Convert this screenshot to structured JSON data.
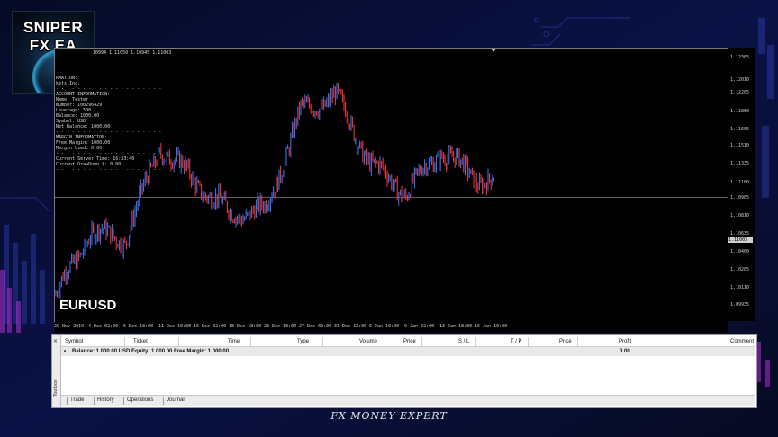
{
  "brand": {
    "line1": "SNIPER",
    "line2": "FX EA"
  },
  "chart": {
    "symbol": "EURUSD",
    "ohlc_line": "10994 1.11050 1.10945 1.11003",
    "info_lines": [
      "RMATION:",
      "kets Inc.",
      "- - - - - - - - - - - - - - - - - - - -",
      "ACCOUNT INFORMATION:",
      "Name: Tester",
      "Number: 100296429",
      "Leverage: 500",
      "Balance: 1000.00",
      "Symbol: USD",
      "Net Balance: 1000.00",
      "- - - - - - - - - - - - - - - - - - - -",
      "MARGIN INFORMATION:",
      "Free Margin: 1000.00",
      "Margin Used: 0.00",
      "- - - - - - - - - - - - - - - - - - - -",
      "Current Server Time: 16:33:40",
      "Current DrawDown $: 0.00",
      "- - - - - - - - - - - - - - - - - - - -"
    ],
    "price_ticks": [
      "1.12305",
      "1.12010",
      "1.12205",
      "1.11860",
      "1.11605",
      "1.11510",
      "1.11335",
      "1.11160",
      "1.10985",
      "1.10810",
      "1.10635",
      "1.10460",
      "1.10285",
      "1.10110",
      "1.09935"
    ],
    "current_price": "1.11003",
    "time_ticks": [
      "29 Nov 2019",
      "4 Dec 02:00",
      "6 Dec 18:00",
      "11 Dec 10:00",
      "16 Dec 02:00",
      "18 Dec 18:00",
      "23 Dec 10:00",
      "27 Dec 02:00",
      "31 Dec 18:00",
      "6 Jan 10:00",
      "9 Jan 02:00",
      "13 Jan 18:00",
      "16 Jan 10:00"
    ],
    "colors": {
      "bull": "#3d7bff",
      "bear": "#ff3a3a",
      "bg": "#000000"
    }
  },
  "chart_data": {
    "type": "line",
    "title": "EURUSD",
    "xlabel": "",
    "ylabel": "",
    "ylim": [
      1.0985,
      1.124
    ],
    "x": [
      "29 Nov 2019",
      "4 Dec 02:00",
      "6 Dec 18:00",
      "11 Dec 10:00",
      "16 Dec 02:00",
      "18 Dec 18:00",
      "23 Dec 10:00",
      "27 Dec 02:00",
      "31 Dec 18:00",
      "6 Jan 10:00",
      "9 Jan 02:00",
      "13 Jan 18:00",
      "16 Jan 10:00"
    ],
    "series": [
      {
        "values": [
          1.1008,
          1.1067,
          1.1061,
          1.1147,
          1.1115,
          1.1084,
          1.1088,
          1.118,
          1.1195,
          1.1131,
          1.1104,
          1.1144,
          1.1117
        ]
      }
    ]
  },
  "terminal": {
    "side_label": "Toolbox",
    "close": "×",
    "columns": [
      "Symbol",
      "Ticket",
      "Time",
      "Type",
      "Volume",
      "Price",
      "S / L",
      "T / P",
      "Price",
      "Profit",
      "Comment"
    ],
    "balance_line": "Balance: 1 000.00 USD  Equity: 1 000.00  Free Margin: 1 000.00",
    "profit_total": "0.00",
    "tabs": [
      "Trade",
      "History",
      "Operations",
      "Journal"
    ]
  },
  "footer": "FX MONEY EXPERT"
}
